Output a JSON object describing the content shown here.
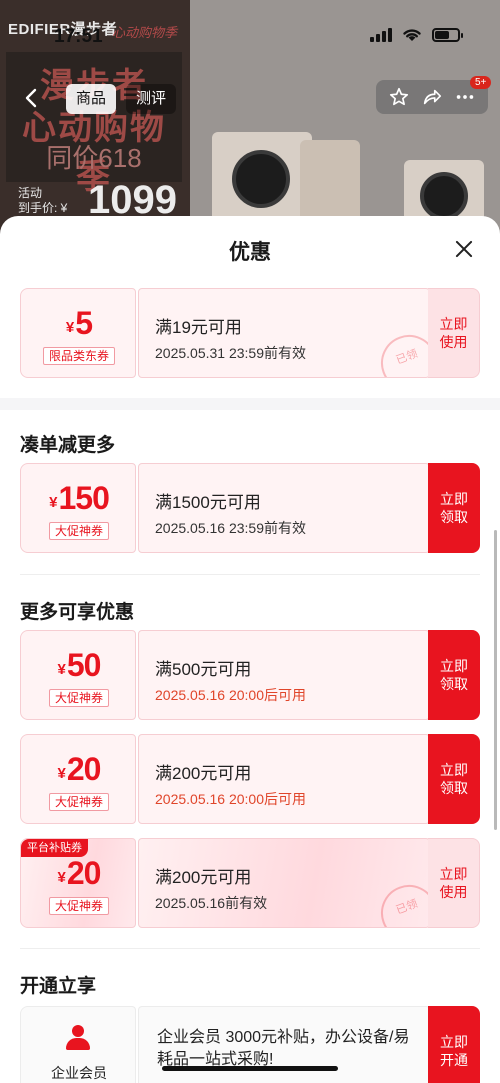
{
  "background": {
    "brand": "EDIFIER漫步者",
    "brand_tagline": "心动购物季",
    "poster_line1": "漫步者",
    "poster_line2": "心动购物季",
    "poster_line3": "同价618",
    "activity_line1": "活动",
    "activity_line2": "到手价: ¥",
    "price": "1099"
  },
  "status_bar": {
    "time": "17:51"
  },
  "nav": {
    "back_icon": "back-arrow-icon",
    "tab_product": "商品",
    "tab_review": "测评",
    "icons": [
      "star-icon",
      "share-icon",
      "more-icon"
    ],
    "badge": "5+"
  },
  "sheet": {
    "title": "优惠",
    "sections": {
      "more_items": "凑单减更多",
      "more_offers": "更多可享优惠",
      "open_share": "开通立享"
    },
    "coupons": [
      {
        "yen": "¥",
        "amount": "5",
        "tag": "限品类东券",
        "condition": "满19元可用",
        "validity": "2025.05.31 23:59前有效",
        "action": "立即使用",
        "stamp": "已领"
      },
      {
        "yen": "¥",
        "amount": "150",
        "tag": "大促神券",
        "condition": "满1500元可用",
        "validity": "2025.05.16 23:59前有效",
        "action": "立即领取"
      },
      {
        "yen": "¥",
        "amount": "50",
        "tag": "大促神券",
        "condition": "满500元可用",
        "validity": "2025.05.16 20:00后可用",
        "action": "立即领取"
      },
      {
        "yen": "¥",
        "amount": "20",
        "tag": "大促神券",
        "condition": "满200元可用",
        "validity": "2025.05.16 20:00后可用",
        "action": "立即领取"
      },
      {
        "yen": "¥",
        "amount": "20",
        "tag": "大促神券",
        "platform_tag": "平台补贴券",
        "condition": "满200元可用",
        "validity": "2025.05.16前有效",
        "action": "立即使用",
        "stamp": "已领"
      }
    ],
    "enterprise": {
      "name": "企业会员",
      "description": "企业会员 3000元补贴，办公设备/易耗品一站式采购!",
      "action": "立即开通"
    }
  },
  "colors": {
    "accent": "#e8141f",
    "coupon_bg": "#fff3f4",
    "date_highlight": "#e0452a"
  }
}
